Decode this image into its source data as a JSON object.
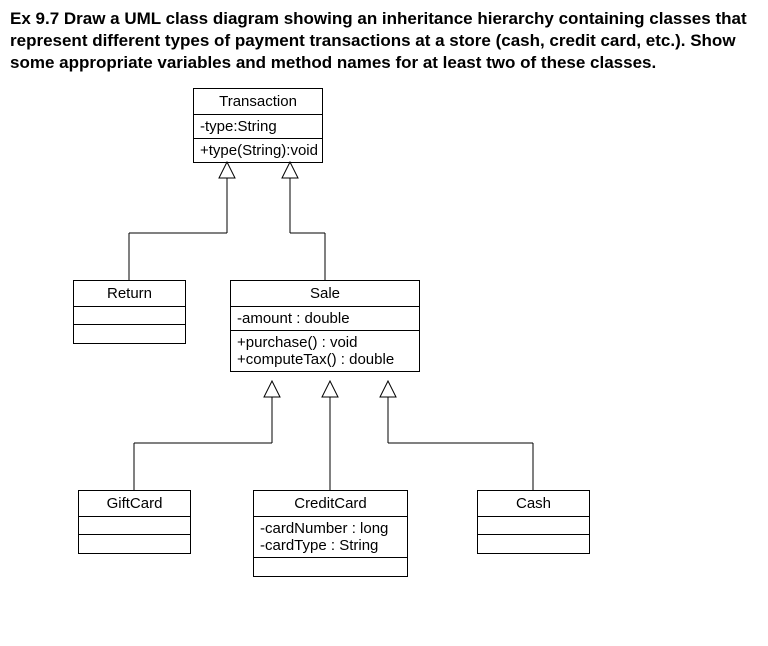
{
  "header": "Ex 9.7 Draw a UML class diagram showing an inheritance hierarchy containing classes that represent different types of payment transactions at a store (cash, credit card, etc.). Show some appropriate variables and method names for at least two of these classes.",
  "classes": {
    "transaction": {
      "name": "Transaction",
      "attributes": [
        "-type:String"
      ],
      "methods": [
        "+type(String):void"
      ]
    },
    "return": {
      "name": "Return",
      "attributes": [],
      "methods": []
    },
    "sale": {
      "name": "Sale",
      "attributes": [
        "-amount : double"
      ],
      "methods": [
        "+purchase() : void",
        "+computeTax() : double"
      ]
    },
    "giftcard": {
      "name": "GiftCard",
      "attributes": [],
      "methods": []
    },
    "creditcard": {
      "name": "CreditCard",
      "attributes": [
        "-cardNumber : long",
        "-cardType : String"
      ],
      "methods": []
    },
    "cash": {
      "name": "Cash",
      "attributes": [],
      "methods": []
    }
  },
  "chart_data": {
    "type": "table",
    "title": "UML class inheritance hierarchy for payment transactions",
    "classes": [
      {
        "name": "Transaction",
        "attributes": [
          "-type:String"
        ],
        "methods": [
          "+type(String):void"
        ],
        "extends": null
      },
      {
        "name": "Return",
        "attributes": [],
        "methods": [],
        "extends": "Transaction"
      },
      {
        "name": "Sale",
        "attributes": [
          "-amount : double"
        ],
        "methods": [
          "+purchase() : void",
          "+computeTax() : double"
        ],
        "extends": "Transaction"
      },
      {
        "name": "GiftCard",
        "attributes": [],
        "methods": [],
        "extends": "Sale"
      },
      {
        "name": "CreditCard",
        "attributes": [
          "-cardNumber : long",
          "-cardType : String"
        ],
        "extends": "Sale"
      },
      {
        "name": "Cash",
        "attributes": [],
        "methods": [],
        "extends": "Sale"
      }
    ]
  }
}
